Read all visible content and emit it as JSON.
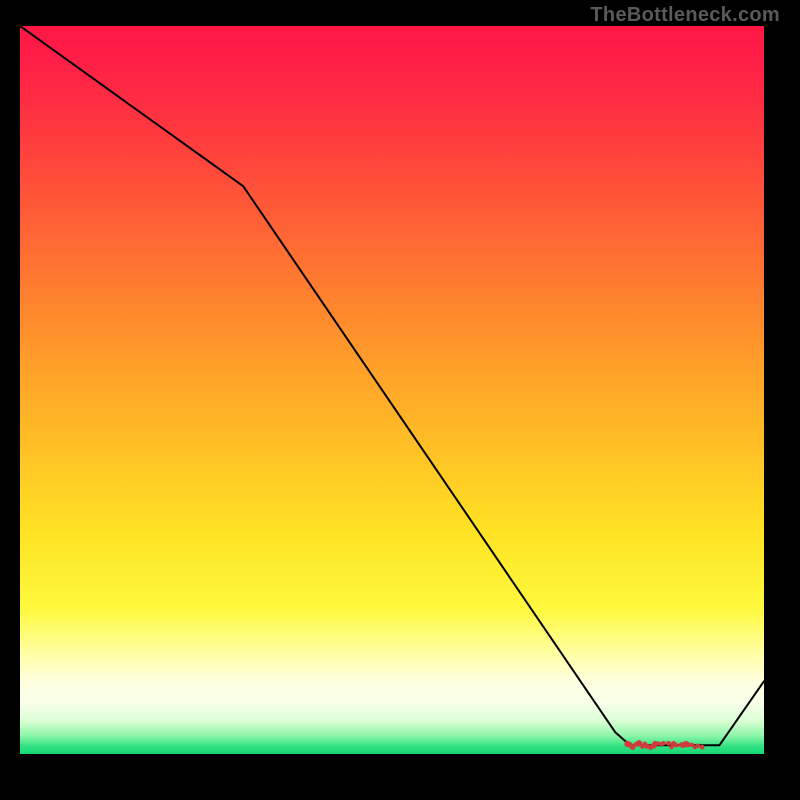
{
  "watermark": "TheBottleneck.com",
  "chart_data": {
    "type": "line",
    "title": "",
    "xlabel": "",
    "ylabel": "",
    "xlim": [
      0,
      1
    ],
    "ylim": [
      0,
      1
    ],
    "gradient_stops": [
      {
        "offset": 0.0,
        "color": "#ff1744"
      },
      {
        "offset": 0.05,
        "color": "#ff1f47"
      },
      {
        "offset": 0.15,
        "color": "#ff3a3f"
      },
      {
        "offset": 0.3,
        "color": "#ff6a33"
      },
      {
        "offset": 0.45,
        "color": "#ff9a2a"
      },
      {
        "offset": 0.58,
        "color": "#ffc025"
      },
      {
        "offset": 0.7,
        "color": "#ffe424"
      },
      {
        "offset": 0.8,
        "color": "#fff83d"
      },
      {
        "offset": 0.86,
        "color": "#ffffa0"
      },
      {
        "offset": 0.9,
        "color": "#ffffe0"
      },
      {
        "offset": 0.93,
        "color": "#f8ffe8"
      },
      {
        "offset": 0.955,
        "color": "#d9ffd4"
      },
      {
        "offset": 0.975,
        "color": "#8cf5a8"
      },
      {
        "offset": 0.99,
        "color": "#2fe082"
      },
      {
        "offset": 1.0,
        "color": "#16d873"
      }
    ],
    "series": [
      {
        "name": "bottleneck-curve",
        "x": [
          0.0,
          0.3,
          0.8,
          0.82,
          0.92,
          0.94,
          1.0
        ],
        "y": [
          1.0,
          0.78,
          0.03,
          0.012,
          0.012,
          0.012,
          0.1
        ],
        "color": "#000000",
        "stroke_width": 2
      }
    ],
    "markers": {
      "name": "optimum-dots",
      "x_start": 0.815,
      "x_end": 0.915,
      "y": 0.012,
      "variant": "random-cluster",
      "color": "#d13b3b",
      "radius": 2
    }
  }
}
